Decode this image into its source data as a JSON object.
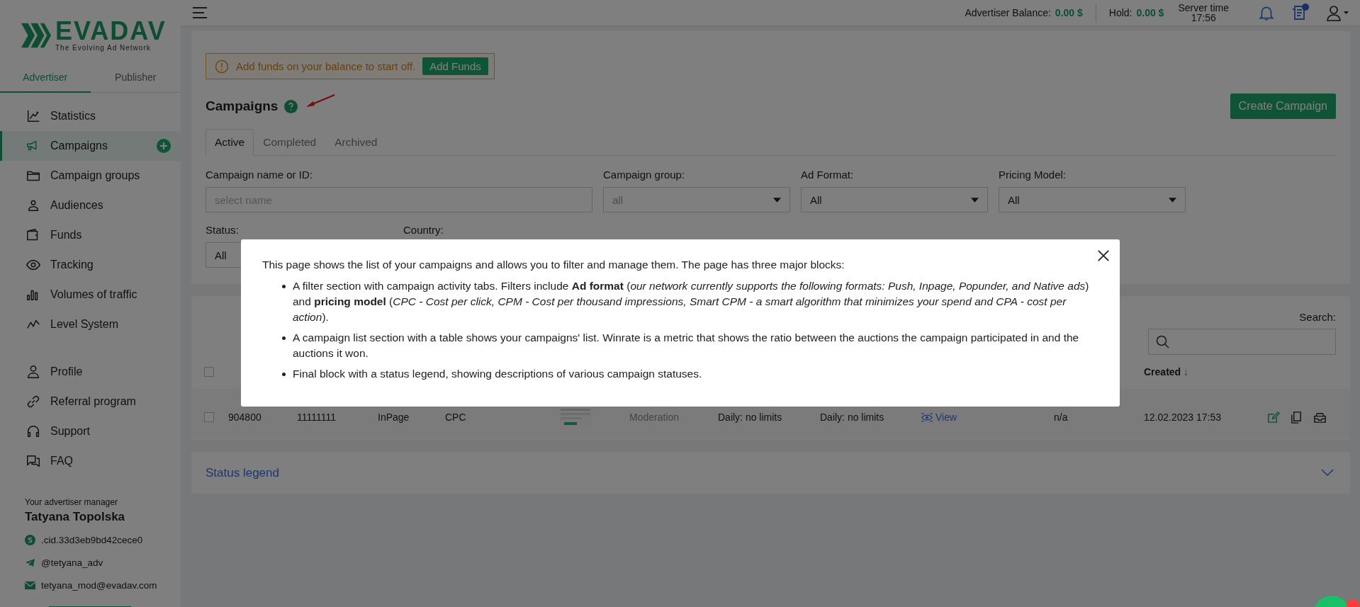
{
  "logo": {
    "name": "EVADAV",
    "tagline": "The Evolving Ad Network"
  },
  "role_tabs": [
    {
      "label": "Advertiser",
      "selected": true
    },
    {
      "label": "Publisher",
      "selected": false
    }
  ],
  "sidebar": {
    "items": [
      {
        "label": "Statistics",
        "selected": false,
        "add_button": false
      },
      {
        "label": "Campaigns",
        "selected": true,
        "add_button": true
      },
      {
        "label": "Campaign groups",
        "selected": false,
        "add_button": false
      },
      {
        "label": "Audiences",
        "selected": false,
        "add_button": false
      },
      {
        "label": "Funds",
        "selected": false,
        "add_button": false
      },
      {
        "label": "Tracking",
        "selected": false,
        "add_button": false
      },
      {
        "label": "Volumes of traffic",
        "selected": false,
        "add_button": false
      },
      {
        "label": "Level System",
        "selected": false,
        "add_button": false
      }
    ],
    "secondary_items": [
      {
        "label": "Profile",
        "selected": false
      },
      {
        "label": "Referral program",
        "selected": false
      },
      {
        "label": "Support",
        "selected": false
      },
      {
        "label": "FAQ",
        "selected": false
      }
    ],
    "manager": {
      "heading": "Your advertiser manager",
      "name": "Tatyana Topolska",
      "contacts": [
        {
          "kind": "skype",
          "value": ".cid.33d3eb9bd42cece0"
        },
        {
          "kind": "telegram",
          "value": "@tetyana_adv"
        },
        {
          "kind": "email",
          "value": "tetyana_mod@evadav.com"
        }
      ]
    }
  },
  "topbar": {
    "balance_label": "Advertiser Balance:",
    "balance": "0.00 $",
    "hold_label": "Hold:",
    "hold": "0.00 $",
    "server_time_label": "Server time",
    "server_time": "17:56",
    "messages_unread": true
  },
  "alert": {
    "text": "Add funds on your balance to start off.",
    "button": "Add Funds"
  },
  "page": {
    "title": "Campaigns",
    "create_button": "Create Campaign"
  },
  "status_tabs": [
    {
      "label": "Active",
      "selected": true
    },
    {
      "label": "Completed",
      "selected": false
    },
    {
      "label": "Archived",
      "selected": false
    }
  ],
  "filters": [
    {
      "label": "Campaign name or ID:",
      "kind": "text",
      "placeholder": "select name"
    },
    {
      "label": "Campaign group:",
      "kind": "select",
      "placeholder": "all"
    },
    {
      "label": "Ad Format:",
      "kind": "select",
      "value": "All"
    },
    {
      "label": "Pricing Model:",
      "kind": "select",
      "value": "All"
    }
  ],
  "filters_row_2": [
    {
      "label": "Status:",
      "kind": "select",
      "value": "All"
    },
    {
      "label": "Country:",
      "kind": "label"
    }
  ],
  "table": {
    "search_label": "Search:",
    "header_checked": false,
    "sort_column": {
      "label": "Created",
      "arrow": "↓"
    },
    "rows": [
      {
        "checked": false,
        "cells": [
          {
            "kind": "text",
            "text": "904800"
          },
          {
            "kind": "text",
            "text": "11111111"
          },
          {
            "kind": "text",
            "text": "InPage"
          },
          {
            "kind": "text",
            "text": "CPC"
          },
          {
            "kind": "thumbnail"
          },
          {
            "kind": "muted",
            "text": "Moderation"
          },
          {
            "kind": "text",
            "text": "Daily: no limits"
          },
          {
            "kind": "text",
            "text": "Daily: no limits"
          },
          {
            "kind": "link",
            "text": "View"
          },
          {
            "kind": "text",
            "text": "n/a"
          },
          {
            "kind": "text",
            "text": "12.02.2023 17:53"
          },
          {
            "kind": "actions"
          }
        ]
      }
    ]
  },
  "status_legend": {
    "title": "Status legend",
    "expanded": false
  },
  "modal": {
    "intro": "This page shows the list of your campaigns and allows you to filter and manage them. The page has three major blocks:",
    "bullets": [
      "A filter section with campaign activity tabs. Filters include **Ad format** (*our network currently supports the following formats: Push, Inpage, Popunder, and Native ads*) and **pricing model** (*CPC - Cost per click, CPM - Cost per thousand impressions, Smart CPM - a smart algorithm that minimizes your spend and CPA - cost per action*).",
      "A campaign list section with a table shows your campaigns' list. Winrate is a metric that shows the ratio between the auctions the campaign participated in and the auctions it won.",
      "Final block with a status legend, showing descriptions of various campaign statuses."
    ]
  }
}
